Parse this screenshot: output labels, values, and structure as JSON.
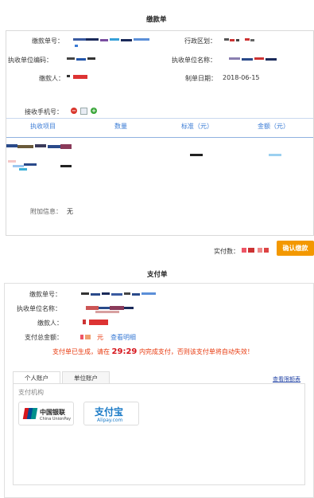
{
  "invoice": {
    "title": "缴款单",
    "fields": {
      "bill_no_label": "缴款单号：",
      "region_label": "行政区划：",
      "org_code_label": "执收单位编码：",
      "org_name_label": "执收单位名称：",
      "payer_label": "缴款人：",
      "date_label": "制单日期：",
      "date_value": "2018-06-15",
      "phone_label": "接收手机号："
    },
    "table_headers": [
      "执收项目",
      "数量",
      "标准（元）",
      "金额（元）"
    ],
    "extra_label": "附加信息：",
    "extra_value": "无",
    "paid_label": "实付数：",
    "confirm_button": "确认缴款"
  },
  "payment": {
    "title": "支付单",
    "bill_no_label": "缴款单号：",
    "org_name_label": "执收单位名称：",
    "payer_label": "缴款人：",
    "total_label": "支付总金额：",
    "total_unit": "元",
    "detail_link": "查看明细",
    "notice_prefix": "支付单已生成，请在",
    "notice_time": "29:29",
    "notice_suffix": "内完成支付，否则该支付单将自动失效！",
    "tabs": [
      "个人账户",
      "单位账户"
    ],
    "quota_link": "查看限额表",
    "institution_label": "支付机构",
    "unionpay_cn": "中国银联",
    "unionpay_en": "China UnionPay",
    "alipay_cn": "支付宝",
    "alipay_en": "Alipay.com"
  },
  "colors": {
    "accent_blue": "#3a7bd5",
    "confirm_orange": "#f39800",
    "notice_red": "#e8380d",
    "unionpay_red": "#d6161d",
    "alipay_blue": "#1a7ac6"
  }
}
